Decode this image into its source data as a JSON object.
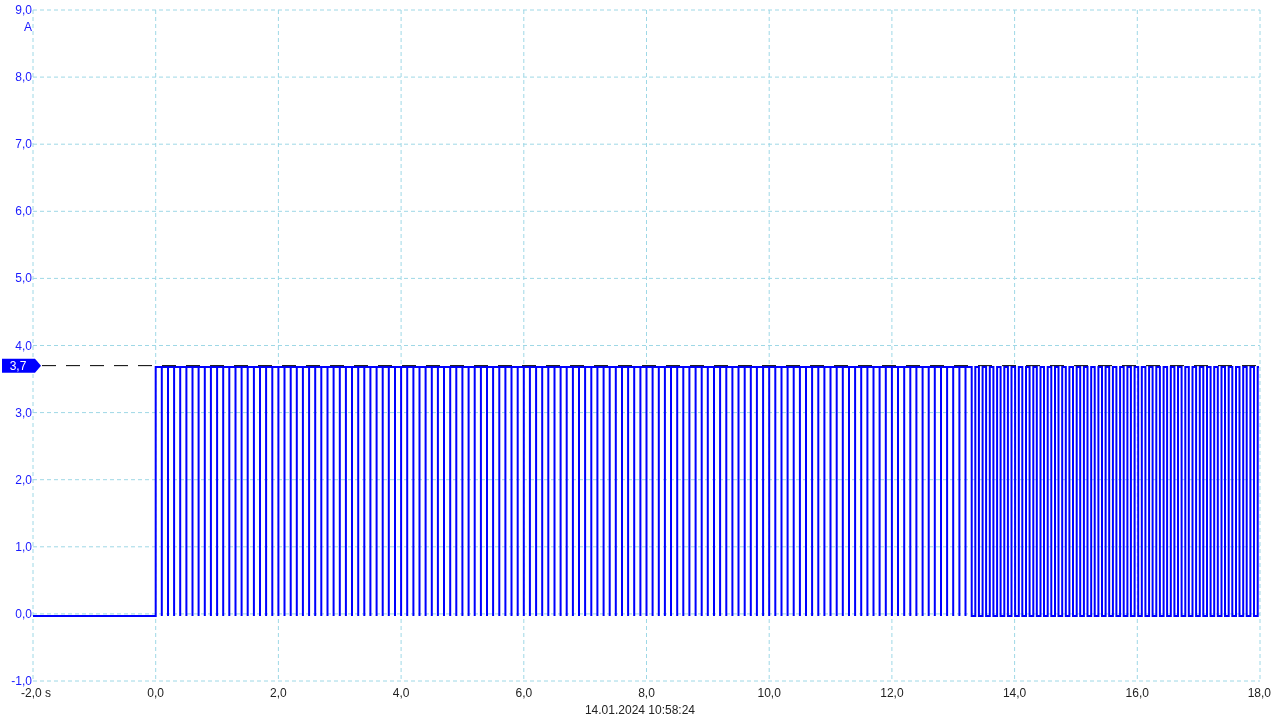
{
  "y_axis": {
    "unit": "A",
    "ticks": [
      "9,0",
      "8,0",
      "7,0",
      "6,0",
      "5,0",
      "4,0",
      "3,0",
      "2,0",
      "1,0",
      "0,0",
      "-1,0"
    ]
  },
  "x_axis": {
    "ticks": [
      "-2,0 s",
      "0,0",
      "2,0",
      "4,0",
      "6,0",
      "8,0",
      "10,0",
      "12,0",
      "14,0",
      "16,0",
      "18,0"
    ]
  },
  "marker": {
    "label": "3,7"
  },
  "timestamp": "14.01.2024 10:58:24"
}
